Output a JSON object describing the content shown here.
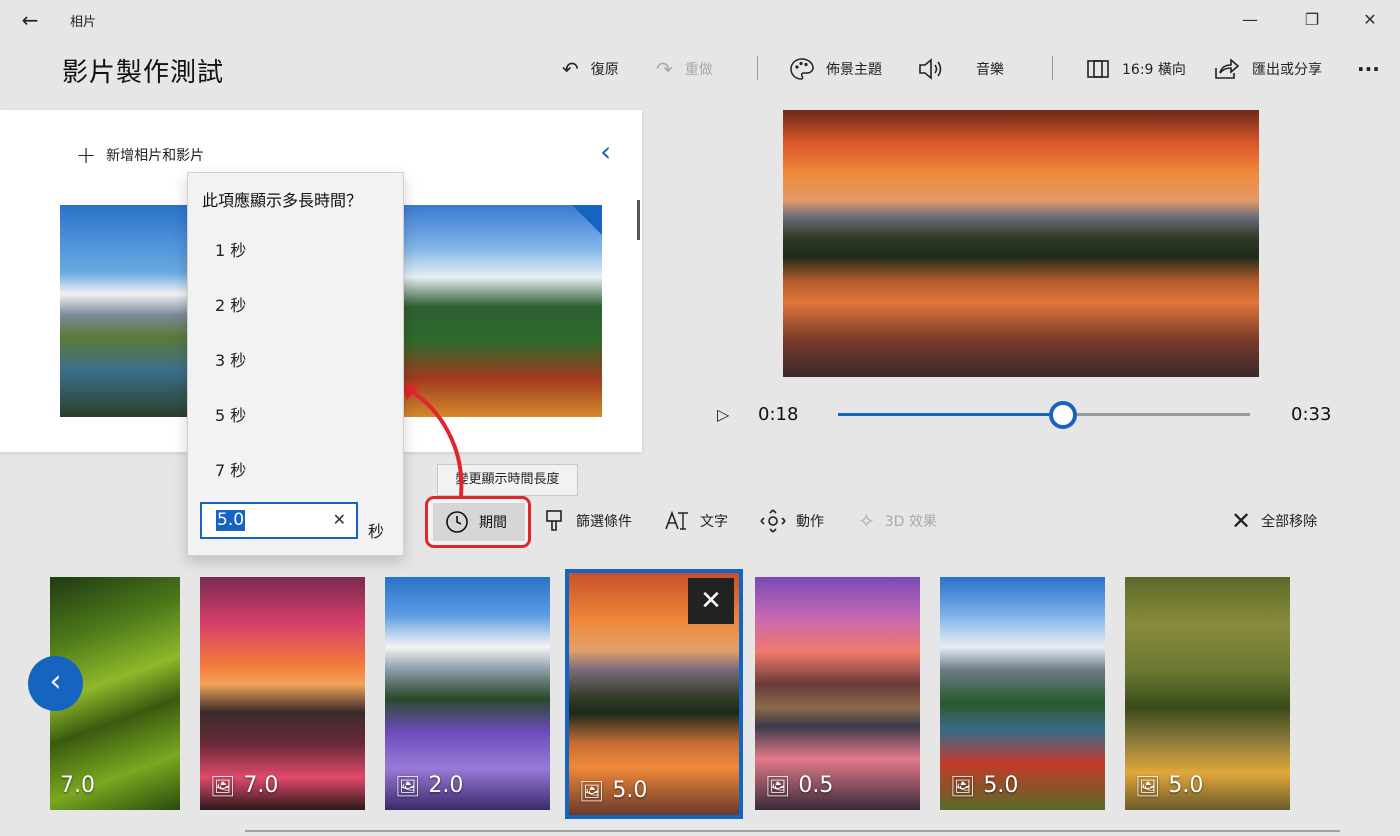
{
  "titlebar": {
    "back_icon": "←",
    "app_name": "相片",
    "minimize": "—",
    "restore": "❐",
    "close": "✕"
  },
  "header": {
    "project_title": "影片製作測試",
    "undo_label": "復原",
    "redo_label": "重做",
    "background_theme_label": "佈景主題",
    "music_label": "音樂",
    "aspect_label": "16:9 橫向",
    "export_label": "匯出或分享",
    "more_label": "···"
  },
  "library": {
    "add_label": "新增相片和影片",
    "collapse_icon": "‹"
  },
  "duration_flyout": {
    "question": "此項應顯示多長時間？",
    "options": [
      "1 秒",
      "2 秒",
      "3 秒",
      "5 秒",
      "7 秒"
    ],
    "input_value": "5.0",
    "clear_icon": "✕",
    "unit": "秒"
  },
  "player": {
    "play_icon": "▷",
    "current_time": "0:18",
    "total_time": "0:33",
    "progress": 0.545
  },
  "toolbar": {
    "tooltip": "變更顯示時間長度",
    "duration_label": "期間",
    "filters_label": "篩選條件",
    "text_label": "文字",
    "motion_label": "動作",
    "effects_label": "3D 效果",
    "remove_all_label": "全部移除"
  },
  "storyboard": {
    "prev_icon": "‹",
    "remove_icon": "✕",
    "cards": [
      {
        "duration": "7.0"
      },
      {
        "duration": "7.0"
      },
      {
        "duration": "2.0"
      },
      {
        "duration": "5.0"
      },
      {
        "duration": "0.5"
      },
      {
        "duration": "5.0"
      },
      {
        "duration": "5.0"
      }
    ]
  },
  "colors": {
    "accent": "#1565c0",
    "highlight_red": "#e0262b",
    "background": "#e6e6e6"
  }
}
